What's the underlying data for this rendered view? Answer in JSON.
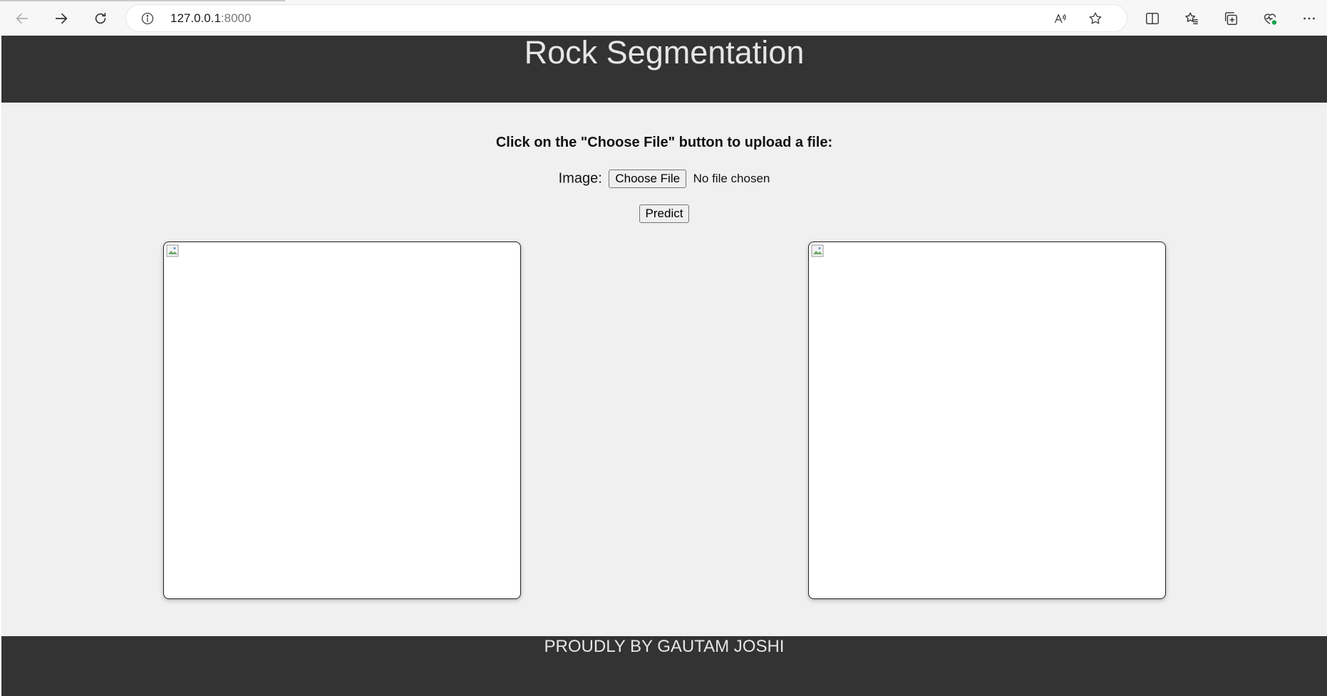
{
  "browser": {
    "url_host": "127.0.0.1",
    "url_port": ":8000",
    "icons": [
      "back-icon",
      "forward-icon",
      "reload-icon",
      "info-icon",
      "read-aloud-icon",
      "favorite-star-icon",
      "split-screen-icon",
      "favorites-icon",
      "collections-icon",
      "browser-essentials-icon",
      "more-options-icon"
    ]
  },
  "header": {
    "title": "Rock Segmentation"
  },
  "main": {
    "instructions": "Click on the \"Choose File\" button to upload a file:",
    "image_label": "Image:",
    "choose_file_label": "Choose File",
    "file_status": "No file chosen",
    "predict_label": "Predict"
  },
  "footer": {
    "text": "PROUDLY BY GAUTAM JOSHI"
  },
  "colors": {
    "header_bg": "#333333",
    "page_bg": "#f0f0f0",
    "header_text": "#e6e6e6"
  }
}
